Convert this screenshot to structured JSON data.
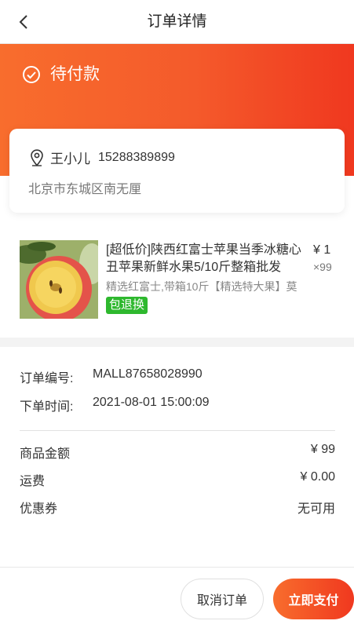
{
  "header": {
    "title": "订单详情",
    "back_icon": "chevron-left-icon"
  },
  "status": {
    "text": "待付款",
    "icon": "check-circle-icon"
  },
  "address": {
    "name": "王小儿",
    "phone": "15288389899",
    "detail": "北京市东城区南无厘",
    "icon": "location-pin-icon"
  },
  "goods": {
    "title": "[超低价]陕西红富士苹果当季冰糖心丑苹果新鲜水果5/10斤整箱批发",
    "spec": "精选红富士,带箱10斤【精选特大果】莫",
    "tag": "包退换",
    "price": "¥ 1",
    "quantity": "×99"
  },
  "order_info": {
    "number_label": "订单编号:",
    "number_value": "MALL87658028990",
    "time_label": "下单时间:",
    "time_value": "2021-08-01 15:00:09"
  },
  "price_summary": {
    "goods_amount_label": "商品金额",
    "goods_amount_value": "¥ 99",
    "shipping_label": "运费",
    "shipping_value": "¥ 0.00",
    "coupon_label": "优惠券",
    "coupon_value": "无可用"
  },
  "actions": {
    "cancel_label": "取消订单",
    "pay_label": "立即支付"
  },
  "colors": {
    "accent_start": "#f86d2d",
    "accent_end": "#f0381f",
    "tag_green": "#2eb82e"
  }
}
